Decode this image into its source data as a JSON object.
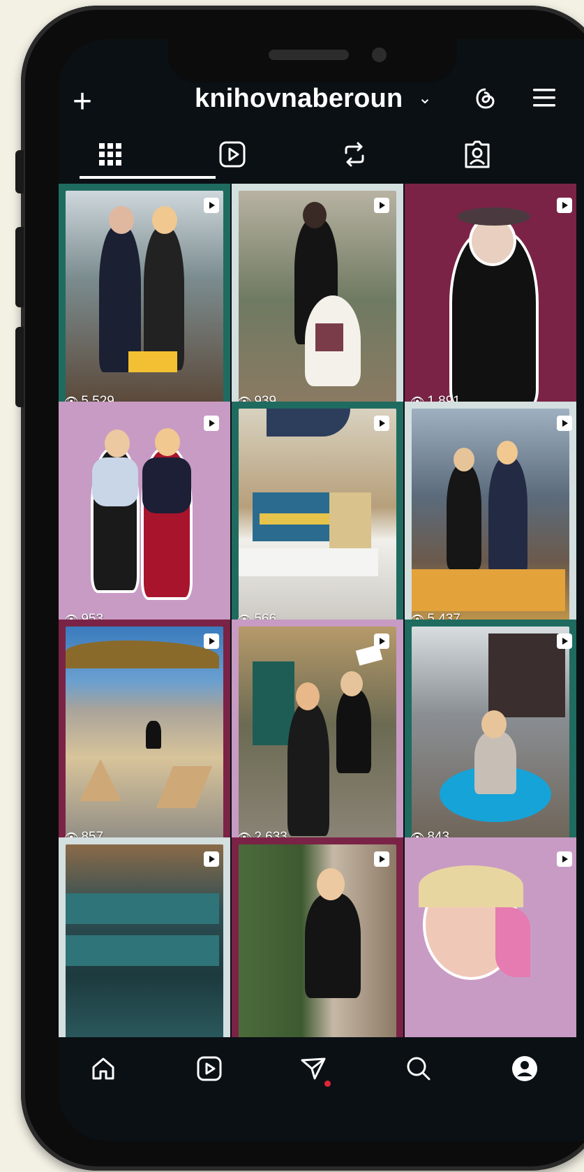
{
  "profile": {
    "username": "knihovnaberoun",
    "chevron": "⌄",
    "add_icon": "plus-icon",
    "threads_icon": "threads-icon",
    "menu_icon": "hamburger-menu-icon"
  },
  "tabs": [
    {
      "name": "grid",
      "icon": "grid-icon",
      "active": true
    },
    {
      "name": "reels",
      "icon": "reels-icon",
      "active": false
    },
    {
      "name": "reposts",
      "icon": "repost-icon",
      "active": false
    },
    {
      "name": "tagged",
      "icon": "tagged-icon",
      "active": false
    }
  ],
  "posts": [
    {
      "views": "5 529",
      "bg": "#1f6b60",
      "inner": "#6d8a9a"
    },
    {
      "views": "939",
      "bg": "#d4dfe0",
      "inner": "#6f7a62"
    },
    {
      "views": "1 891",
      "bg": "#7a2346",
      "inner": "#7a2346"
    },
    {
      "views": "953",
      "bg": "#c89bc4",
      "inner": "#c89bc4"
    },
    {
      "views": "566",
      "bg": "#1f6b60",
      "inner": "#c7b79a"
    },
    {
      "views": "5 437",
      "bg": "#d4dfe0",
      "inner": "#5b6b7c"
    },
    {
      "views": "857",
      "bg": "#7a2346",
      "inner": "#3a7bbd"
    },
    {
      "views": "2 633",
      "bg": "#c89bc4",
      "inner": "#6b6a52"
    },
    {
      "views": "843",
      "bg": "#1f6b60",
      "inner": "#8a8f94"
    },
    {
      "views": "",
      "bg": "#d4dfe0",
      "inner": "#2f4f54"
    },
    {
      "views": "",
      "bg": "#7a2346",
      "inner": "#4c6b3b"
    },
    {
      "views": "",
      "bg": "#c89bc4",
      "inner": "#c89bc4"
    }
  ],
  "bottom_nav": [
    {
      "name": "home",
      "icon": "home-icon"
    },
    {
      "name": "reels",
      "icon": "reels-icon"
    },
    {
      "name": "messages",
      "icon": "send-icon",
      "badge": true
    },
    {
      "name": "search",
      "icon": "search-icon"
    },
    {
      "name": "profile",
      "icon": "profile-icon"
    }
  ],
  "colors": {
    "accent_red": "#e0243a",
    "background": "#0b1014",
    "page": "#f3f0e4"
  }
}
